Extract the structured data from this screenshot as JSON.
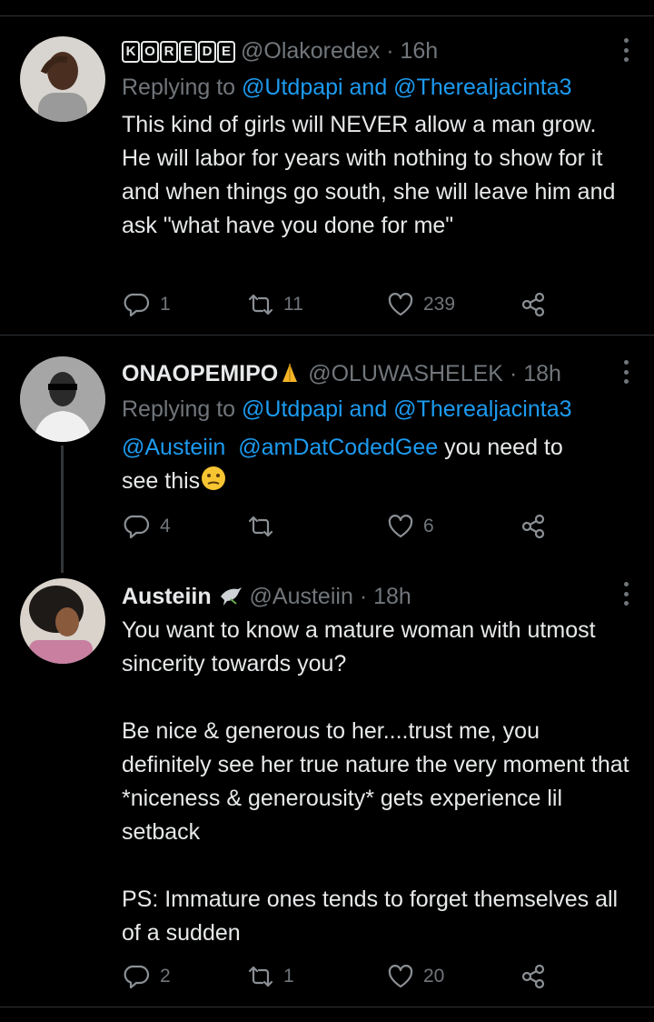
{
  "tweets": [
    {
      "display_name": "KOREDE",
      "display_letters": [
        "K",
        "O",
        "R",
        "E",
        "D",
        "E"
      ],
      "handle": "@Olakoredex",
      "sep": "·",
      "time": "16h",
      "replying_prefix": "Replying to",
      "replying_to": "@Utdpapi and @Therealjacinta3",
      "text": "This kind of girls will NEVER allow a man grow. He will labor for years with nothing to show for it and when things go south, she will leave him and ask \"what have you done for me\"",
      "replies": "1",
      "retweets": "11",
      "likes": "239"
    },
    {
      "display_name": "ONAOPEMIPO",
      "handle": "@OLUWASHELEK",
      "sep": "·",
      "time": "18h",
      "replying_prefix": "Replying to",
      "replying_to": "@Utdpapi and @Therealjacinta3",
      "mention1": "@Austeiin",
      "mention2": "@amDatCodedGee",
      "text_tail": " you need to",
      "text_line2": "see this",
      "replies": "4",
      "retweets": "",
      "likes": "6"
    },
    {
      "display_name": "Austeiin",
      "handle": "@Austeiin",
      "sep": "·",
      "time": "18h",
      "text": "You want to know a mature woman with utmost sincerity towards you?\n\nBe nice & generous to her....trust me, you definitely see her true nature the very moment that *niceness & generousity* gets experience lil setback\n\nPS: Immature ones tends to forget themselves all of a sudden",
      "replies": "2",
      "retweets": "1",
      "likes": "20"
    }
  ],
  "icons": {
    "reply": "reply-icon",
    "retweet": "retweet-icon",
    "like": "heart-icon",
    "share": "share-icon",
    "more": "more-icon"
  },
  "colors": {
    "background": "#000000",
    "text": "#e7e9ea",
    "muted": "#71767b",
    "link": "#1d9bf0"
  }
}
